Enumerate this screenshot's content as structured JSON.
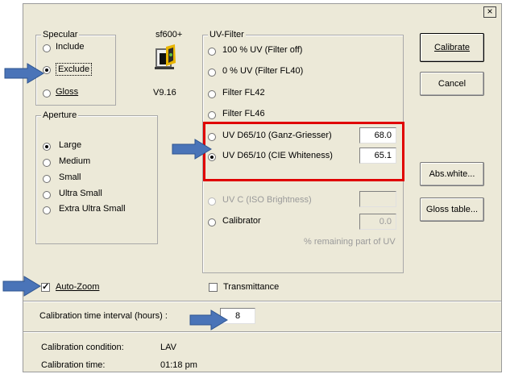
{
  "close_glyph": "×",
  "specular": {
    "title": "Specular",
    "options": [
      "Include",
      "Exclude",
      "Gloss"
    ],
    "selected": "Exclude"
  },
  "device": {
    "model": "sf600+",
    "version": "V9.16",
    "icon": "spectrophotometer-icon"
  },
  "aperture": {
    "title": "Aperture",
    "options": [
      "Large",
      "Medium",
      "Small",
      "Ultra Small",
      "Extra Ultra Small"
    ],
    "selected": "Large"
  },
  "uv_filter": {
    "title": "UV-Filter",
    "options": [
      "100 % UV (Filter off)",
      "0 % UV (Filter FL40)",
      "Filter FL42",
      "Filter FL46",
      "UV D65/10 (Ganz-Griesser)",
      "UV D65/10 (CIE Whiteness)",
      "UV C (ISO Brightness)",
      "Calibrator"
    ],
    "selected": "UV D65/10 (CIE Whiteness)",
    "ganz_griesser_value": "68.0",
    "cie_whiteness_value": "65.1",
    "uv_c_value": "",
    "calibrator_value": "0.0",
    "remaining_note": "% remaining part of UV"
  },
  "buttons": {
    "calibrate": "Calibrate",
    "cancel": "Cancel",
    "abs_white": "Abs.white...",
    "gloss_table": "Gloss table..."
  },
  "auto_zoom": {
    "label": "Auto-Zoom",
    "checked": true
  },
  "transmittance": {
    "label": "Transmittance",
    "checked": false
  },
  "calibration_interval": {
    "label": "Calibration time interval (hours) :",
    "value": "8"
  },
  "calibration_condition": {
    "label": "Calibration condition:",
    "value": "LAV"
  },
  "calibration_time": {
    "label": "Calibration time:",
    "value": "01:18 pm"
  },
  "colors": {
    "highlight": "#e00000",
    "arrow": "#4a74b8",
    "dialog_bg": "#ece9d8"
  }
}
